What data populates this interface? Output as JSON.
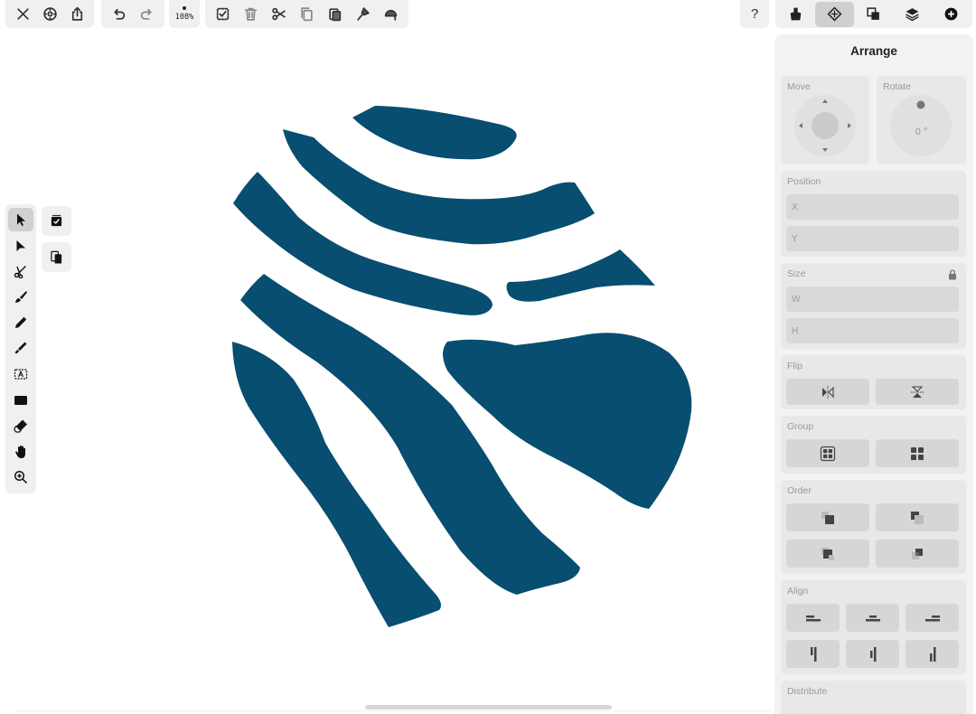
{
  "toolbar": {
    "zoom_label": "108%",
    "help_label": "?"
  },
  "panel": {
    "title": "Arrange",
    "move_label": "Move",
    "rotate_label": "Rotate",
    "rotate_value": "0 °",
    "position_label": "Position",
    "x_label": "X",
    "y_label": "Y",
    "size_label": "Size",
    "w_label": "W",
    "h_label": "H",
    "flip_label": "Flip",
    "group_label": "Group",
    "order_label": "Order",
    "align_label": "Align",
    "distribute_label": "Distribute"
  },
  "colors": {
    "shape_fill": "#074e70",
    "panel_bg": "#f2f2f2",
    "section_bg": "#e8e8e8"
  },
  "icons": {
    "top_left": [
      "close-icon",
      "settings-icon",
      "share-icon"
    ],
    "history": [
      "undo-icon",
      "redo-icon"
    ],
    "edit": [
      "select-all-icon",
      "delete-icon",
      "cut-icon",
      "copy-icon",
      "paste-icon",
      "paint-style-icon",
      "fill-icon"
    ],
    "right": [
      "help-icon",
      "style-icon",
      "arrange-icon",
      "boolean-icon",
      "layers-icon",
      "add-icon"
    ],
    "tools": [
      "select-icon",
      "direct-select-icon",
      "scissors-icon",
      "brush-icon",
      "pencil-icon",
      "calligraphy-pen-icon",
      "text-icon",
      "rectangle-icon",
      "eraser-icon",
      "hand-icon",
      "zoom-icon"
    ]
  }
}
